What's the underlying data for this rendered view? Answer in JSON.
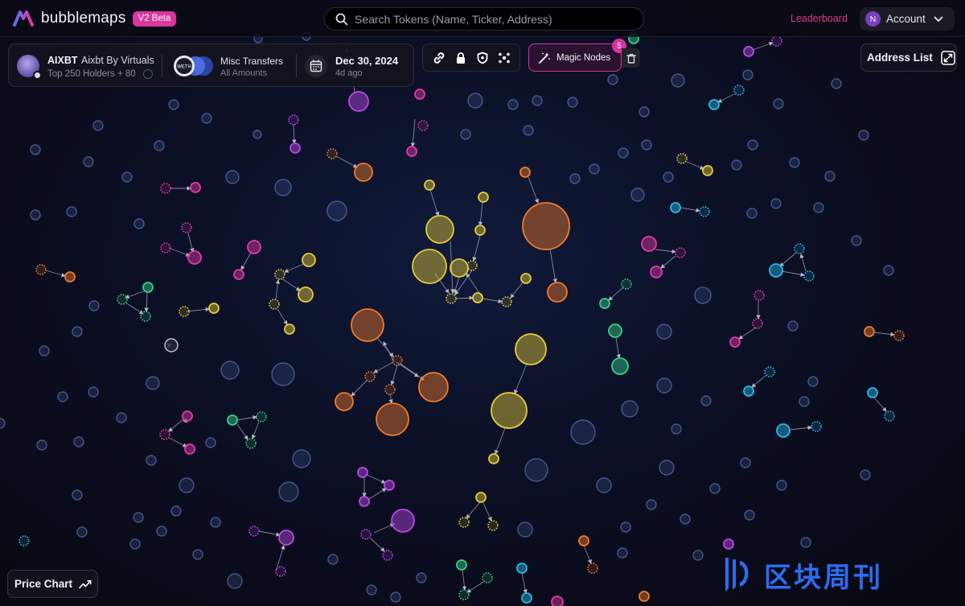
{
  "header": {
    "brand_name": "bubblemaps",
    "beta_badge": "V2 Beta",
    "search_placeholder": "Search Tokens (Name, Ticker, Address)",
    "leaderboard_label": "Leaderboard",
    "account_initial": "N",
    "account_label": "Account"
  },
  "token_panel": {
    "ticker": "AIXBT",
    "name": "Aixbt By Virtuals",
    "holders": "Top 250 Holders + 80",
    "weth_label": "WETH",
    "transfer_type": "Misc Transfers",
    "transfer_amount": "All Amounts",
    "date": "Dec 30, 2024",
    "date_ago": "4d ago"
  },
  "toolbar": {
    "tools": [
      "link-icon",
      "lock-icon",
      "shield-icon",
      "cluster-icon"
    ],
    "magic_label": "Magic Nodes",
    "magic_count": "5"
  },
  "address_list_label": "Address List",
  "price_chart_label": "Price Chart",
  "watermark_text": "区块周刊",
  "colors": {
    "accent_pink": "#d4359f",
    "neutral_bubble": "#5a7ab8",
    "yellow": "#e4cc3a",
    "orange": "#f07a2c",
    "pink": "#e23aa8",
    "purple": "#b84ae6",
    "green": "#36cf86",
    "cyan": "#2ab8e6"
  }
}
